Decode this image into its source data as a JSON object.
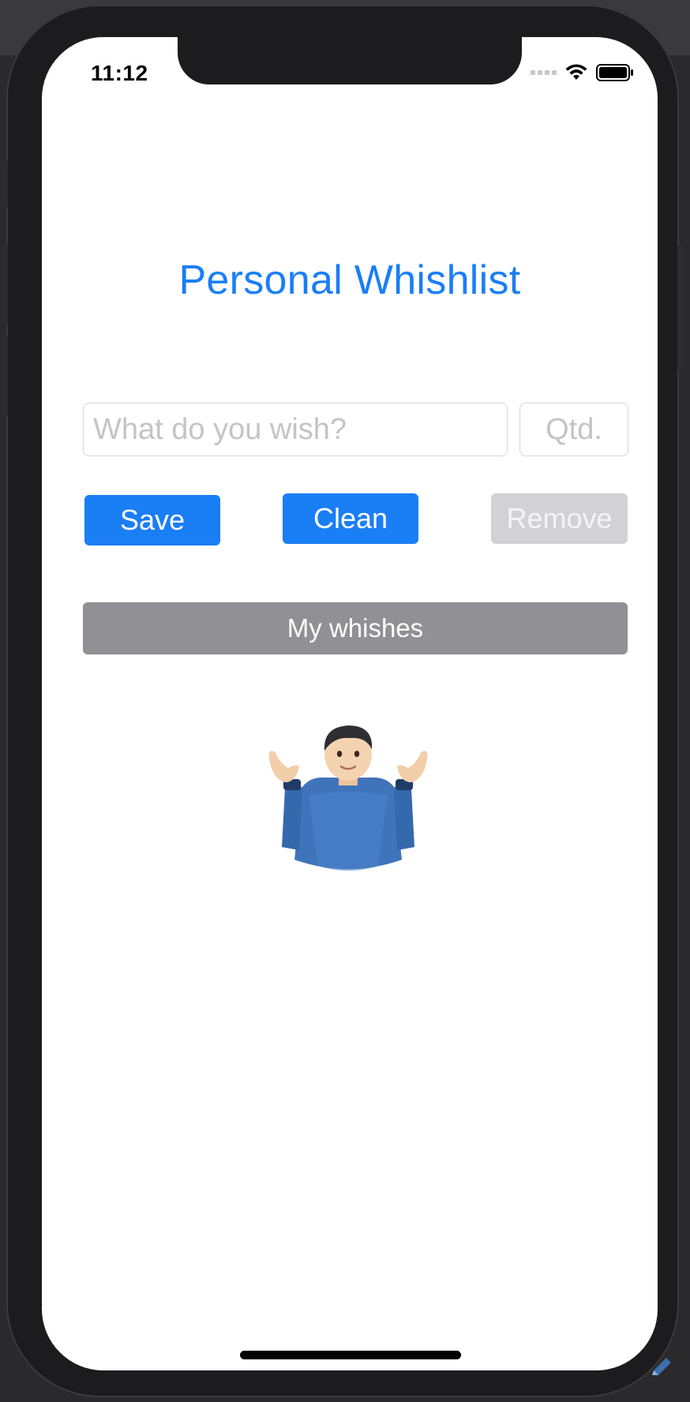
{
  "status_bar": {
    "time": "11:12",
    "signal_icon": "signal-icon",
    "wifi_icon": "wifi-icon",
    "battery_icon": "battery-icon"
  },
  "main": {
    "title": "Personal Whishlist",
    "wish_input": {
      "value": "",
      "placeholder": "What do you wish?"
    },
    "qty_input": {
      "value": "",
      "placeholder": "Qtd."
    },
    "buttons": {
      "save": "Save",
      "clean": "Clean",
      "remove": "Remove",
      "my_wishes": "My whishes"
    },
    "empty_state_icon": "man-shrugging-emoji"
  },
  "colors": {
    "accent": "#1a7ef5",
    "disabled": "#d2d2d6",
    "secondary": "#909095"
  }
}
